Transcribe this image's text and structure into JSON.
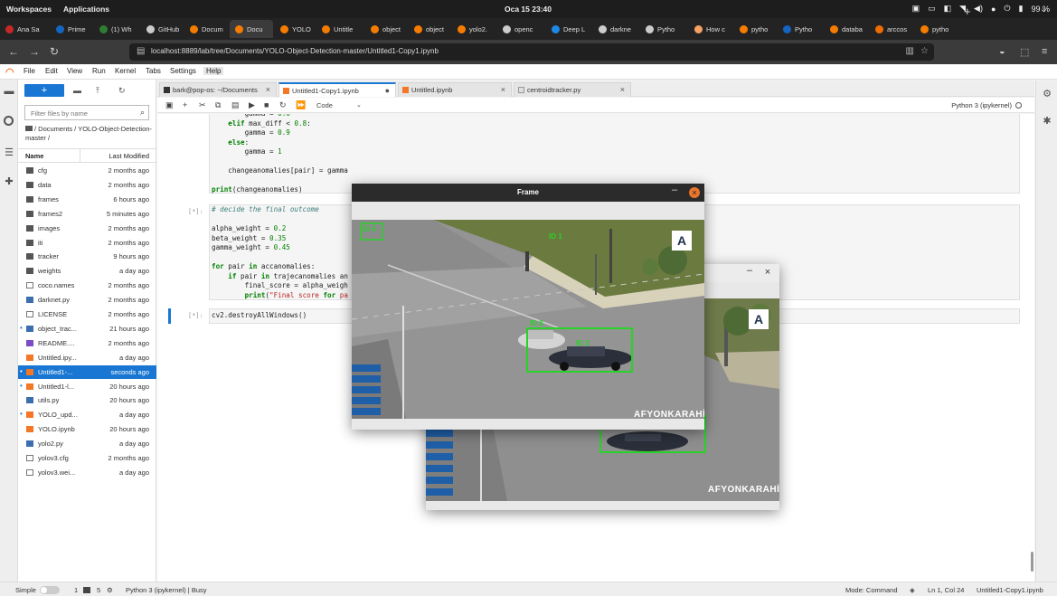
{
  "os": {
    "workspaces": "Workspaces",
    "applications": "Applications",
    "clock": "Oca 15  23:40",
    "battery": "99 %"
  },
  "browser": {
    "tabs": [
      {
        "label": "Ana Sa",
        "color": "#c62828"
      },
      {
        "label": "Prime",
        "color": "#1565c0"
      },
      {
        "label": "(1) Wh",
        "color": "#2e7d32"
      },
      {
        "label": "GitHub",
        "color": "#cccccc"
      },
      {
        "label": "Docum",
        "color": "#f57c00"
      },
      {
        "label": "Docu",
        "color": "#f57c00"
      },
      {
        "label": "YOLO",
        "color": "#f57c00"
      },
      {
        "label": "Untitle",
        "color": "#f57c00"
      },
      {
        "label": "object",
        "color": "#f57c00"
      },
      {
        "label": "object",
        "color": "#f57c00"
      },
      {
        "label": "yolo2.",
        "color": "#f57c00"
      },
      {
        "label": "openc",
        "color": "#cccccc"
      },
      {
        "label": "Deep L",
        "color": "#1e88e5"
      },
      {
        "label": "darkne",
        "color": "#cccccc"
      },
      {
        "label": "Pytho",
        "color": "#cccccc"
      },
      {
        "label": "How c",
        "color": "#f4a261"
      },
      {
        "label": "pytho",
        "color": "#f57c00"
      },
      {
        "label": "Pytho",
        "color": "#1565c0"
      },
      {
        "label": "databa",
        "color": "#f57c00"
      },
      {
        "label": "arccos",
        "color": "#ef6c00"
      },
      {
        "label": "pytho",
        "color": "#f57c00"
      }
    ],
    "url": "localhost:8889/lab/tree/Documents/YOLO-Object-Detection-master/Untitled1-Copy1.ipynb"
  },
  "jupyter": {
    "menu": [
      "File",
      "Edit",
      "View",
      "Run",
      "Kernel",
      "Tabs",
      "Settings",
      "Help"
    ],
    "filter_placeholder": "Filter files by name",
    "breadcrumb": "/ Documents / YOLO-Object-Detection-master /",
    "col_name": "Name",
    "col_modified": "Last Modified",
    "files": [
      {
        "name": "cfg",
        "modified": "2 months ago",
        "type": "folder"
      },
      {
        "name": "data",
        "modified": "2 months ago",
        "type": "folder"
      },
      {
        "name": "frames",
        "modified": "6 hours ago",
        "type": "folder"
      },
      {
        "name": "frames2",
        "modified": "5 minutes ago",
        "type": "folder"
      },
      {
        "name": "images",
        "modified": "2 months ago",
        "type": "folder"
      },
      {
        "name": "iti",
        "modified": "2 months ago",
        "type": "folder"
      },
      {
        "name": "tracker",
        "modified": "9 hours ago",
        "type": "folder"
      },
      {
        "name": "weights",
        "modified": "a day ago",
        "type": "folder"
      },
      {
        "name": "coco.names",
        "modified": "2 months ago",
        "type": "file"
      },
      {
        "name": "darknet.py",
        "modified": "2 months ago",
        "type": "py"
      },
      {
        "name": "LICENSE",
        "modified": "2 months ago",
        "type": "file"
      },
      {
        "name": "object_trac...",
        "modified": "21 hours ago",
        "type": "py",
        "running": true
      },
      {
        "name": "README....",
        "modified": "2 months ago",
        "type": "md"
      },
      {
        "name": "Untitled.ipy...",
        "modified": "a day ago",
        "type": "nb"
      },
      {
        "name": "Untitled1-...",
        "modified": "seconds ago",
        "type": "nb",
        "running": true,
        "selected": true
      },
      {
        "name": "Untitled1-l...",
        "modified": "20 hours ago",
        "type": "nb",
        "running": true
      },
      {
        "name": "utils.py",
        "modified": "20 hours ago",
        "type": "py"
      },
      {
        "name": "YOLO_upd...",
        "modified": "a day ago",
        "type": "nb",
        "running": true
      },
      {
        "name": "YOLO.ipynb",
        "modified": "20 hours ago",
        "type": "nb"
      },
      {
        "name": "yolo2.py",
        "modified": "a day ago",
        "type": "py"
      },
      {
        "name": "yolov3.cfg",
        "modified": "2 months ago",
        "type": "file"
      },
      {
        "name": "yolov3.wei...",
        "modified": "a day ago",
        "type": "file"
      }
    ],
    "doc_tabs": [
      "bark@pop-os: ~/Documents",
      "Untitled1-Copy1.ipynb",
      "Untitled.ipynb",
      "centroidtracker.py"
    ],
    "cell_type": "Code",
    "kernel": "Python 3 (ipykernel)",
    "code_lines_1": [
      "        gamma = 0.6",
      "    elif max_diff < 0.8:",
      "        gamma = 0.9",
      "    else:",
      "        gamma = 1",
      "",
      "    changeanomalies[pair] = gamma",
      "",
      "print(changeanomalies)"
    ],
    "prompt_2": "[*]:",
    "code_lines_2": [
      "# decide the final outcome",
      "",
      "alpha_weight = 0.2",
      "beta_weight = 0.35",
      "gamma_weight = 0.45",
      "",
      "for pair in accanomalies:",
      "    if pair in trajecanomalies an",
      "        final_score = alpha_weigh",
      "        print(\"Final score for pa"
    ],
    "prompt_3": "[*]:",
    "code_line_3": "cv2.destroyAllWindows()"
  },
  "status": {
    "simple": "Simple",
    "count1": "1",
    "count2": "5",
    "kernel_status": "Python 3 (ipykernel) | Busy",
    "mode": "Mode: Command",
    "position": "Ln 1, Col 24",
    "file": "Untitled1-Copy1.ipynb"
  },
  "frame_window": {
    "title": "Frame",
    "watermark": "AFYONKARAHİS",
    "logo": "A",
    "labels": [
      "ID 5",
      "ID 1",
      "ID 8",
      "ID 2"
    ]
  },
  "frame_window_2": {
    "watermark": "AFYONKARAHİS",
    "logo": "A"
  },
  "colors": {
    "accent": "#1976d2",
    "jupyter_orange": "#f37726",
    "detection_green": "#27d327"
  }
}
